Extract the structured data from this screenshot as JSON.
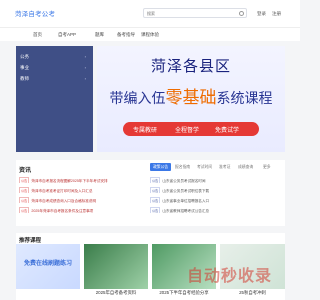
{
  "header": {
    "logo": "菏泽自考公考",
    "search_placeholder": "搜索",
    "links": [
      "登录",
      "注册"
    ]
  },
  "nav": [
    "首页",
    "自考APP",
    "题库",
    "备考指导",
    "课程体验"
  ],
  "sidebar": [
    "公务",
    "事业",
    "教师"
  ],
  "banner": {
    "title": "菏泽各县区",
    "line2_pre": "带编入伍",
    "line2_hl": "零基础",
    "line2_post": "系统课程",
    "pill": [
      "专属教研",
      "全程督学",
      "免费试学"
    ]
  },
  "news": {
    "title": "资讯",
    "tabs": [
      "政策公告",
      "报名指南",
      "考试时间",
      "准考证",
      "成绩查询",
      "更多"
    ],
    "left_rows": [
      {
        "tag": "公告",
        "text": "菏泽市自考报名流程图解2025年下半年考试安排"
      },
      {
        "tag": "公告",
        "text": "菏泽市自考准考证打印时间及入口汇总"
      },
      {
        "tag": "公告",
        "text": "菏泽市自考成绩查询入口及合格标准说明"
      },
      {
        "tag": "公告",
        "text": "2025年菏泽市自考报名条件及注意事项"
      }
    ],
    "right_rows": [
      {
        "tag": "公告",
        "text": "山东省公务员考试报名时间"
      },
      {
        "tag": "公告",
        "text": "山东省公务员考试职位表下载"
      },
      {
        "tag": "公告",
        "text": "山东省事业单位招聘报名入口"
      },
      {
        "tag": "公告",
        "text": "山东省教师招聘考试公告汇总"
      }
    ]
  },
  "courses": {
    "title": "推荐课程",
    "cards": [
      {
        "cap": "免费在线刷题练习"
      },
      {
        "cap": "2025年自考备考资料"
      },
      {
        "cap": "2025下半年自考经验分享"
      },
      {
        "cap": "25秋自考冲刺"
      }
    ]
  },
  "watermark": "自动秒收录"
}
